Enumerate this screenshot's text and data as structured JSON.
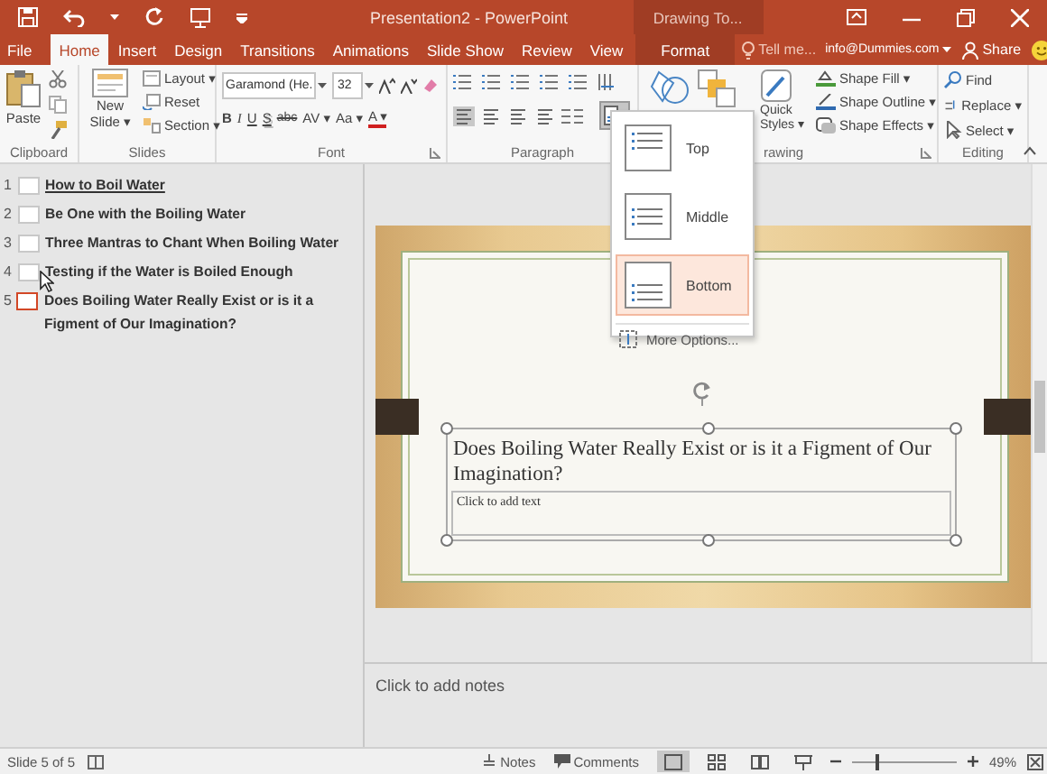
{
  "title_bar": {
    "title": "Presentation2 - PowerPoint",
    "context_group": "Drawing To..."
  },
  "tabs": [
    {
      "label": "File",
      "selected": false,
      "kind": "file"
    },
    {
      "label": "Home",
      "selected": true,
      "kind": "normal"
    },
    {
      "label": "Insert",
      "selected": false,
      "kind": "normal"
    },
    {
      "label": "Design",
      "selected": false,
      "kind": "normal"
    },
    {
      "label": "Transitions",
      "selected": false,
      "kind": "normal"
    },
    {
      "label": "Animations",
      "selected": false,
      "kind": "normal"
    },
    {
      "label": "Slide Show",
      "selected": false,
      "kind": "normal"
    },
    {
      "label": "Review",
      "selected": false,
      "kind": "normal"
    },
    {
      "label": "View",
      "selected": false,
      "kind": "normal"
    },
    {
      "label": "Format",
      "selected": false,
      "kind": "context"
    }
  ],
  "tell_me": "Tell me...",
  "account": "info@Dummies.com",
  "share": "Share",
  "ribbon": {
    "clipboard": {
      "label": "Clipboard",
      "paste": "Paste"
    },
    "slides": {
      "label": "Slides",
      "new_slide": "New Slide ▾",
      "layout": "Layout ▾",
      "reset": "Reset",
      "section": "Section ▾"
    },
    "font": {
      "label": "Font",
      "font_name": "Garamond (He.",
      "font_size": "32",
      "buttons": [
        {
          "label": "B",
          "kind": "bold"
        },
        {
          "label": "I",
          "kind": "italic"
        },
        {
          "label": "U",
          "kind": "underline"
        },
        {
          "label": "S",
          "kind": "shadow"
        },
        {
          "label": "abc",
          "kind": "strike"
        },
        {
          "label": "AV ▾",
          "kind": "spacing"
        },
        {
          "label": "Aa ▾",
          "kind": "case"
        },
        {
          "label": "A ▾",
          "kind": "color"
        }
      ]
    },
    "paragraph": {
      "label": "Paragraph"
    },
    "drawing": {
      "label": "rawing",
      "quick_styles": "Quick Styles ▾",
      "shape_fill": "Shape Fill ▾",
      "shape_outline": "Shape Outline ▾",
      "shape_effects": "Shape Effects ▾"
    },
    "editing": {
      "label": "Editing",
      "find": "Find",
      "replace": "Replace ▾",
      "select": "Select ▾"
    }
  },
  "align_menu": {
    "items": [
      {
        "label": "Top",
        "kind": "top",
        "selected": false
      },
      {
        "label": "Middle",
        "kind": "middle",
        "selected": false
      },
      {
        "label": "Bottom",
        "kind": "bottom",
        "selected": true
      }
    ],
    "more": "More Options..."
  },
  "outline": [
    {
      "number": "1",
      "title": "How to Boil Water",
      "selected": false,
      "underlined": true
    },
    {
      "number": "2",
      "title": "Be One with the Boiling Water",
      "selected": false,
      "underlined": false
    },
    {
      "number": "3",
      "title": "Three Mantras to Chant When Boiling Water",
      "selected": false,
      "underlined": false
    },
    {
      "number": "4",
      "title": "Testing if the Water is Boiled Enough",
      "selected": false,
      "underlined": false
    },
    {
      "number": "5",
      "title": "Does Boiling Water Really Exist or is it a Figment of Our Imagination?",
      "selected": true,
      "underlined": false
    }
  ],
  "slide": {
    "title": "Does Boiling Water Really Exist or is it a Figment of Our Imagination?",
    "subtitle_placeholder": "Click to add text"
  },
  "notes": {
    "placeholder": "Click to add notes"
  },
  "status_bar": {
    "slide_info": "Slide 5 of 5",
    "notes": "Notes",
    "comments": "Comments",
    "views": [
      {
        "kind": "normal",
        "selected": true
      },
      {
        "kind": "sorter",
        "selected": false
      },
      {
        "kind": "reading",
        "selected": false
      },
      {
        "kind": "show",
        "selected": false
      }
    ],
    "zoom_slider": {
      "level": 0.23
    },
    "zoom": "49%"
  }
}
